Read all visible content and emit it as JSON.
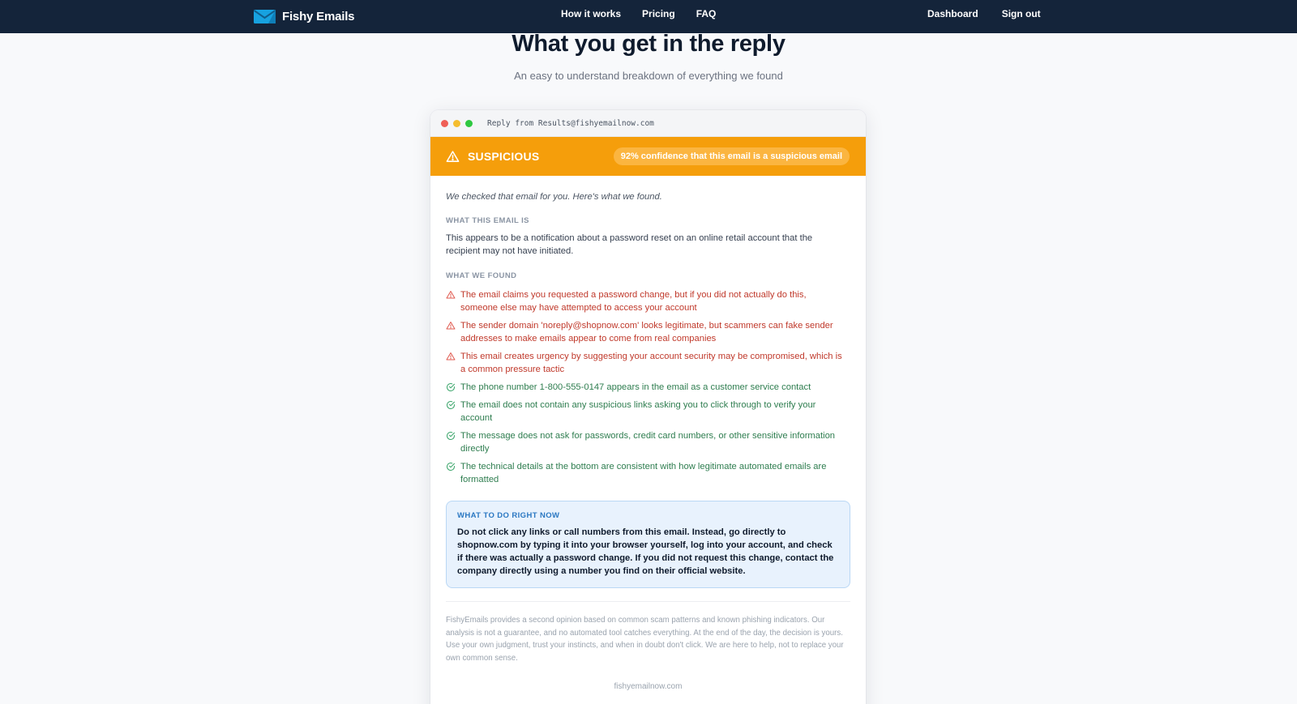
{
  "nav": {
    "brand": "Fishy Emails",
    "links": [
      "How it works",
      "Pricing",
      "FAQ"
    ],
    "dashboard": "Dashboard",
    "signout": "Sign out"
  },
  "hero": {
    "title": "What you get in the reply",
    "subtitle": "An easy to understand breakdown of everything we found"
  },
  "card": {
    "window_title": "Reply from Results@fishyemailnow.com",
    "banner": {
      "label": "SUSPICIOUS",
      "confidence": "92% confidence that this email is a suspicious email",
      "color": "#f59e0b"
    },
    "intro": "We checked that email for you. Here's what we found.",
    "what_label": "WHAT THIS EMAIL IS",
    "summary": "This appears to be a notification about a password reset on an online retail account that the recipient may not have initiated.",
    "found_label": "WHAT WE FOUND",
    "findings": [
      {
        "kind": "warning",
        "icon": "warning-triangle-icon",
        "text": "The email claims you requested a password change, but if you did not actually do this, someone else may have attempted to access your account"
      },
      {
        "kind": "warning",
        "icon": "warning-triangle-icon",
        "text": "The sender domain 'noreply@shopnow.com' looks legitimate, but scammers can fake sender addresses to make emails appear to come from real companies"
      },
      {
        "kind": "warning",
        "icon": "warning-triangle-icon",
        "text": "This email creates urgency by suggesting your account security may be compromised, which is a common pressure tactic"
      },
      {
        "kind": "ok",
        "icon": "check-circle-icon",
        "text": "The phone number 1-800-555-0147 appears in the email as a customer service contact"
      },
      {
        "kind": "ok",
        "icon": "check-circle-icon",
        "text": "The email does not contain any suspicious links asking you to click through to verify your account"
      },
      {
        "kind": "ok",
        "icon": "check-circle-icon",
        "text": "The message does not ask for passwords, credit card numbers, or other sensitive information directly"
      },
      {
        "kind": "ok",
        "icon": "check-circle-icon",
        "text": "The technical details at the bottom are consistent with how legitimate automated emails are formatted"
      }
    ],
    "action": {
      "label": "WHAT TO DO RIGHT NOW",
      "text": "Do not click any links or call numbers from this email. Instead, go directly to shopnow.com by typing it into your browser yourself, log into your account, and check if there was actually a password change. If you did not request this change, contact the company directly using a number you find on their official website."
    },
    "disclaimer": "FishyEmails provides a second opinion based on common scam patterns and known phishing indicators. Our analysis is not a guarantee, and no automated tool catches everything. At the end of the day, the decision is yours. Use your own judgment, trust your instincts, and when in doubt don't click. We are here to help, not to replace your own common sense.",
    "footer": "fishyemailnow.com"
  },
  "colors": {
    "nav_bg": "#14243a",
    "warning_text": "#c0392b",
    "ok_text": "#2e7d4f",
    "action_bg": "#e8f2fd"
  }
}
